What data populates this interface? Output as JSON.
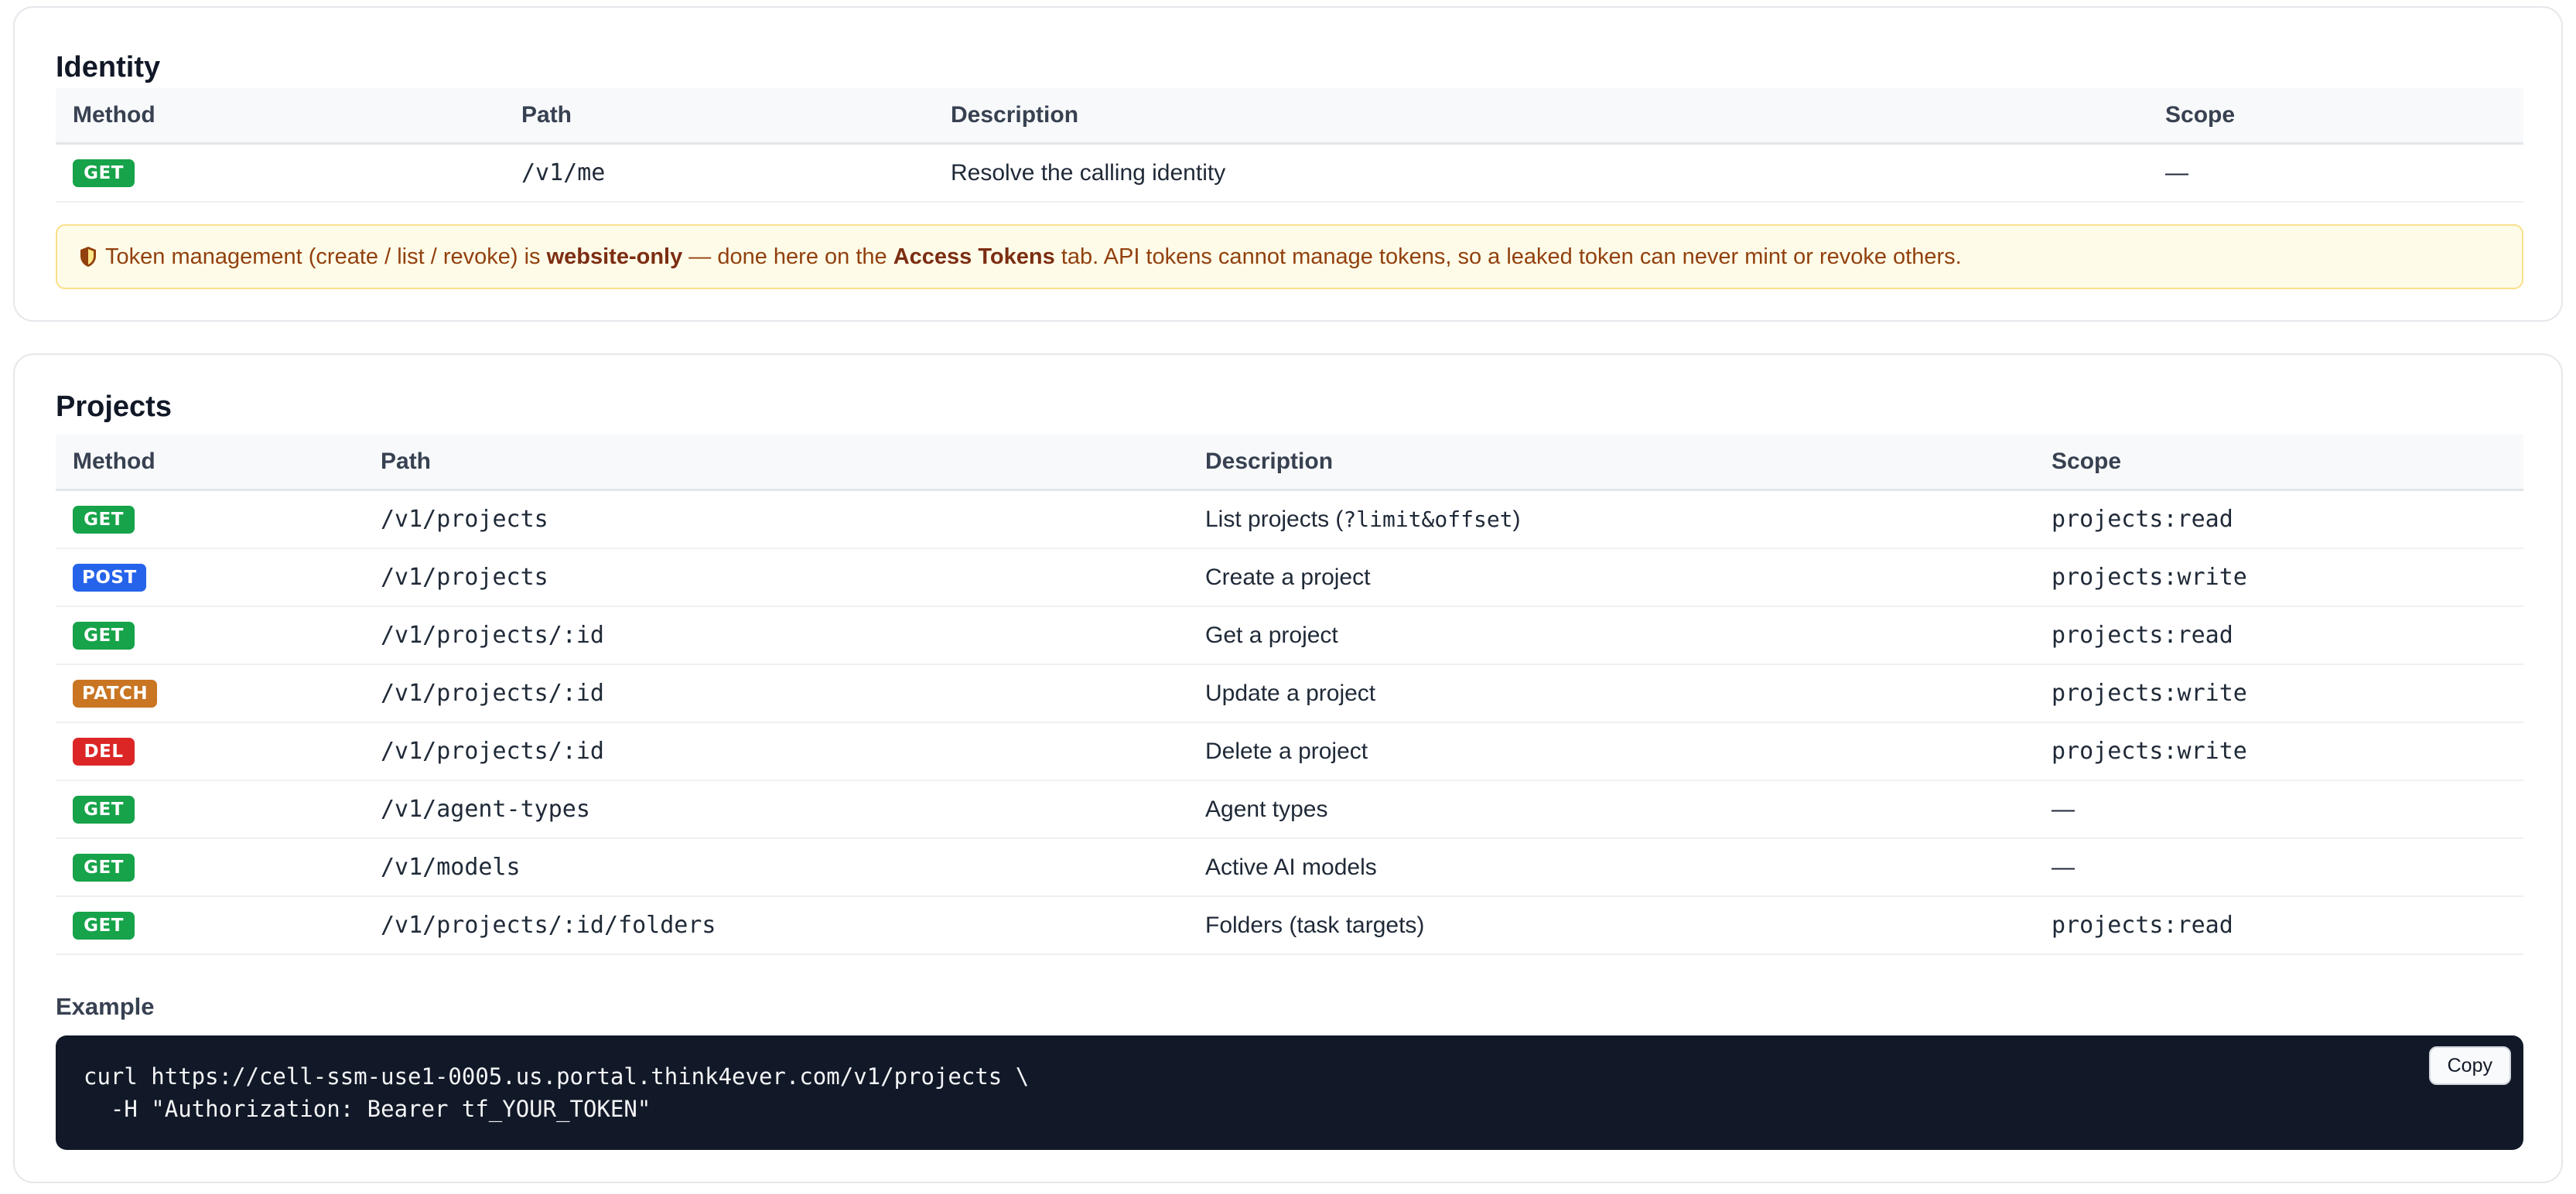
{
  "identity": {
    "title": "Identity",
    "headers": [
      "Method",
      "Path",
      "Description",
      "Scope"
    ],
    "rows": [
      {
        "method": "GET",
        "path": "/v1/me",
        "description": "Resolve the calling identity",
        "scope": "—"
      }
    ],
    "notice": {
      "icon": "shield-icon",
      "text_1": "Token management (create / list / revoke) is ",
      "bold_1": "website-only",
      "text_2": " — done here on the ",
      "bold_2": "Access Tokens",
      "text_3": " tab. API tokens cannot manage tokens, so a leaked token can never mint or revoke others."
    }
  },
  "projects": {
    "title": "Projects",
    "headers": [
      "Method",
      "Path",
      "Description",
      "Scope"
    ],
    "rows": [
      {
        "method": "GET",
        "path": "/v1/projects",
        "description_text": "List projects (",
        "description_code": "?limit&offset",
        "description_tail": ")",
        "scope": "projects:read"
      },
      {
        "method": "POST",
        "path": "/v1/projects",
        "description": "Create a project",
        "scope": "projects:write"
      },
      {
        "method": "GET",
        "path": "/v1/projects/:id",
        "description": "Get a project",
        "scope": "projects:read"
      },
      {
        "method": "PATCH",
        "path": "/v1/projects/:id",
        "description": "Update a project",
        "scope": "projects:write"
      },
      {
        "method": "DEL",
        "path": "/v1/projects/:id",
        "description": "Delete a project",
        "scope": "projects:write"
      },
      {
        "method": "GET",
        "path": "/v1/agent-types",
        "description": "Agent types",
        "scope": "—"
      },
      {
        "method": "GET",
        "path": "/v1/models",
        "description": "Active AI models",
        "scope": "—"
      },
      {
        "method": "GET",
        "path": "/v1/projects/:id/folders",
        "description": "Folders (task targets)",
        "scope": "projects:read"
      }
    ],
    "example": {
      "label": "Example",
      "line_1": "curl https://cell-ssm-use1-0005.us.portal.think4ever.com/v1/projects \\",
      "line_2": "  -H \"Authorization: Bearer tf_YOUR_TOKEN\"",
      "copy_label": "Copy"
    }
  },
  "colors": {
    "get": "#16a34a",
    "post": "#2563eb",
    "patch": "#c97522",
    "del": "#dc2626",
    "notice_bg": "#fefce8",
    "code_bg": "#111827"
  }
}
